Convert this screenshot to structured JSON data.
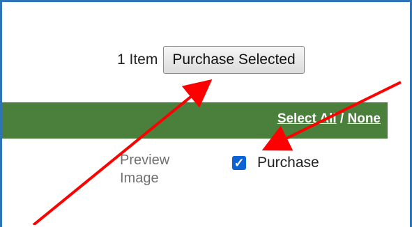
{
  "toolbar": {
    "item_count": "1 Item",
    "purchase_selected_label": "Purchase Selected"
  },
  "grid_header": {
    "select_all_label": "Select All",
    "separator": " / ",
    "none_label": "None"
  },
  "row": {
    "preview_label": "Preview Image",
    "purchase_label": "Purchase",
    "purchase_checked": true
  },
  "colors": {
    "frame": "#2e75b6",
    "header_green": "#4a7f3c",
    "checkbox": "#0b63d6",
    "annotation_arrow": "#ff0000"
  }
}
